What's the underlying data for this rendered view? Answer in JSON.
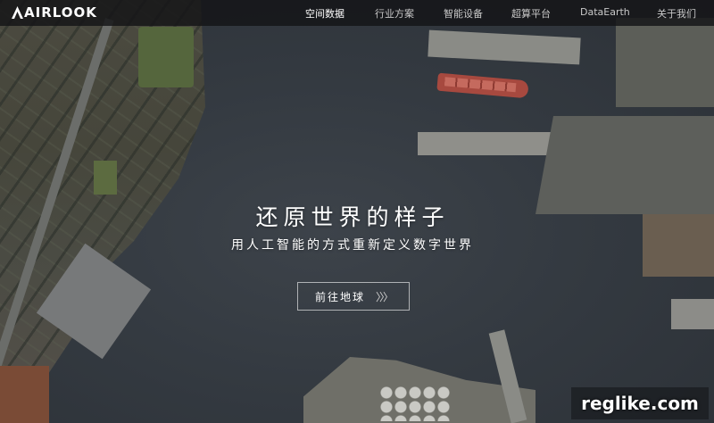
{
  "header": {
    "logo_text": "AIRLOOK",
    "nav": [
      {
        "label": "空间数据",
        "active": true
      },
      {
        "label": "行业方案",
        "active": false
      },
      {
        "label": "智能设备",
        "active": false
      },
      {
        "label": "超算平台",
        "active": false
      },
      {
        "label": "DataEarth",
        "active": false
      },
      {
        "label": "关于我们",
        "active": false
      }
    ]
  },
  "hero": {
    "title": "还原世界的样子",
    "subtitle": "用人工智能的方式重新定义数字世界",
    "cta_label": "前往地球",
    "cta_arrows": "〉〉〉"
  },
  "watermark": "reglike.com",
  "colors": {
    "navbar_bg": "#141416",
    "text_primary": "#ffffff",
    "text_nav_inactive": "#c8c8c8",
    "water": "#343a41"
  },
  "icons": {
    "cta": "triple-chevron-right-icon"
  }
}
